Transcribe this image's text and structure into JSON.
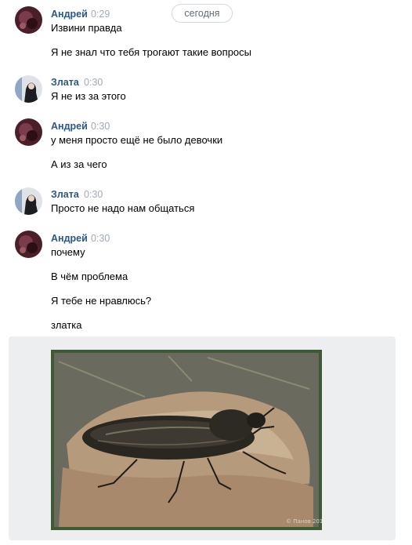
{
  "date_divider": "сегодня",
  "messages": [
    {
      "author": "Андрей",
      "time": "0:29",
      "lines": [
        "Извини правда",
        "Я не знал что тебя трогают такие вопросы"
      ]
    },
    {
      "author": "Злата",
      "time": "0:30",
      "lines": [
        "Я не из за этого"
      ]
    },
    {
      "author": "Андрей",
      "time": "0:30",
      "lines": [
        "у меня просто ещё не было девочки",
        "А из за чего"
      ]
    },
    {
      "author": "Злата",
      "time": "0:30",
      "lines": [
        "Просто не надо нам общаться"
      ]
    },
    {
      "author": "Андрей",
      "time": "0:30",
      "lines": [
        "почему",
        "В чём проблема",
        "Я тебе не нравлюсь?",
        "златка"
      ]
    }
  ],
  "photo": {
    "watermark": "© Панов 2015"
  },
  "colors": {
    "author": "#2a5885",
    "time": "#a0aab6",
    "photo_bg": "#edeef0",
    "photo_frame": "#3e5a34"
  }
}
